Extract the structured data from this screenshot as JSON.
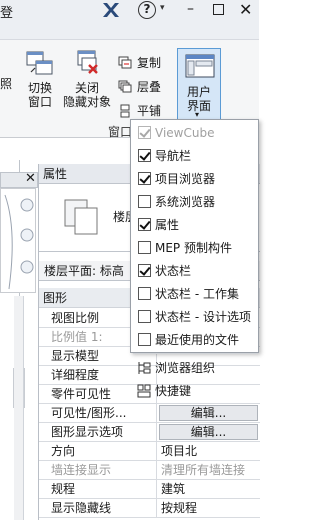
{
  "titlebar": {
    "store_label": "登",
    "help_caret": "▾",
    "min_glyph": "–",
    "close_glyph": "✕"
  },
  "ribbon": {
    "partial_label": "照",
    "switch_window": {
      "line1": "切换",
      "line2": "窗口"
    },
    "close_hidden": {
      "line1": "关闭",
      "line2": "隐藏对象"
    },
    "copy": "复制",
    "cascade": "层叠",
    "tile": "平铺",
    "user_interface": {
      "line1": "用户",
      "line2": "界面"
    },
    "panel_label": "窗口"
  },
  "view": {
    "close_glyph": "✕"
  },
  "properties": {
    "header": "属性",
    "type_name": "楼层",
    "instance_label": "楼层平面: 标高",
    "section": "图形",
    "rows": [
      {
        "k": "视图比例",
        "v": "",
        "kgray": false,
        "vbtn": false
      },
      {
        "k": "比例值 1:",
        "v": "",
        "kgray": true,
        "vbtn": false
      },
      {
        "k": "显示模型",
        "v": "",
        "kgray": false,
        "vbtn": false
      },
      {
        "k": "详细程度",
        "v": "",
        "kgray": false,
        "vbtn": false
      },
      {
        "k": "零件可见性",
        "v": "",
        "kgray": false,
        "vbtn": false
      },
      {
        "k": "可见性/图形...",
        "v": "编辑...",
        "kgray": false,
        "vbtn": true
      },
      {
        "k": "图形显示选项",
        "v": "编辑...",
        "kgray": false,
        "vbtn": true
      },
      {
        "k": "方向",
        "v": "项目北",
        "kgray": false,
        "vbtn": false
      },
      {
        "k": "墙连接显示",
        "v": "清理所有墙连接",
        "kgray": true,
        "vbtn": false,
        "vgray": true
      },
      {
        "k": "规程",
        "v": "建筑",
        "kgray": false,
        "vbtn": false
      },
      {
        "k": "显示隐藏线",
        "v": "按规程",
        "kgray": false,
        "vbtn": false
      }
    ]
  },
  "menu": {
    "items": [
      {
        "label": "ViewCube",
        "checked": true,
        "dim": true
      },
      {
        "label": "导航栏",
        "checked": true,
        "dim": false
      },
      {
        "label": "项目浏览器",
        "checked": true,
        "dim": false
      },
      {
        "label": "系统浏览器",
        "checked": false,
        "dim": false
      },
      {
        "label": "属性",
        "checked": true,
        "dim": false
      },
      {
        "label": "MEP 预制构件",
        "checked": false,
        "dim": false
      },
      {
        "label": "状态栏",
        "checked": true,
        "dim": false
      },
      {
        "label": "状态栏 - 工作集",
        "checked": false,
        "dim": false
      },
      {
        "label": "状态栏 - 设计选项",
        "checked": false,
        "dim": false
      },
      {
        "label": "最近使用的文件",
        "checked": false,
        "dim": false
      }
    ],
    "browser_org": "浏览器组织",
    "shortcuts": "快捷键"
  }
}
